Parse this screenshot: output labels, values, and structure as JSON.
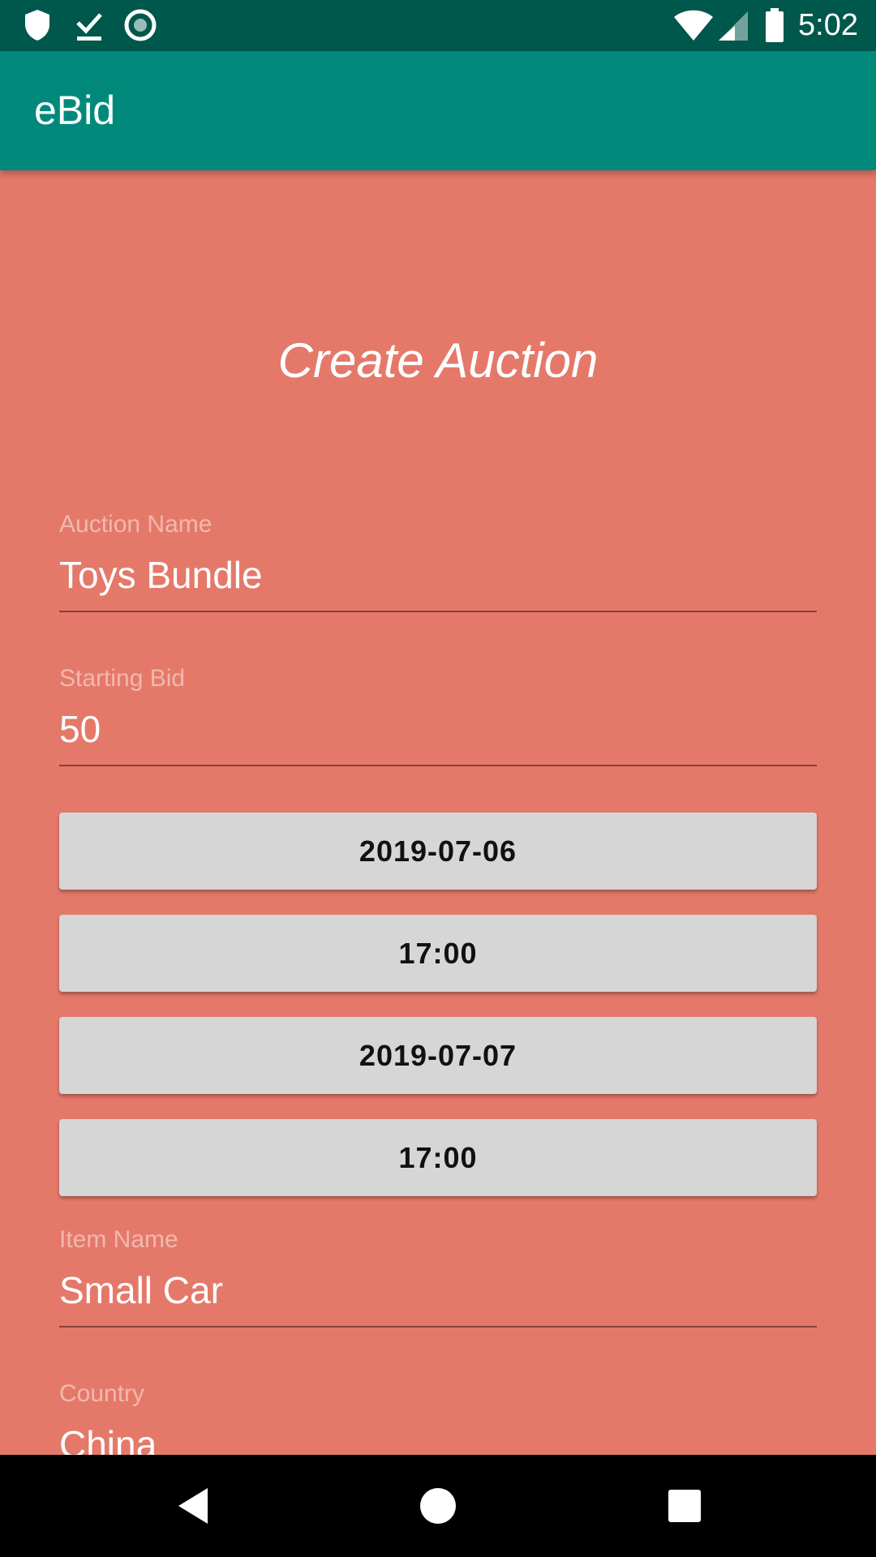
{
  "status_bar": {
    "time": "5:02",
    "icons": [
      "shield-icon",
      "download-done-icon",
      "record-circle-icon",
      "wifi-icon",
      "cell-signal-icon",
      "battery-icon"
    ]
  },
  "app_bar": {
    "title": "eBid"
  },
  "form": {
    "heading": "Create Auction",
    "auction_name": {
      "label": "Auction Name",
      "value": "Toys Bundle"
    },
    "starting_bid": {
      "label": "Starting Bid",
      "value": "50"
    },
    "start_date_button": "2019-07-06",
    "start_time_button": "17:00",
    "end_date_button": "2019-07-07",
    "end_time_button": "17:00",
    "item_name": {
      "label": "Item Name",
      "value": "Small Car"
    },
    "country": {
      "label": "Country",
      "value": "China"
    }
  },
  "nav_bar": {
    "icons": [
      "back-icon",
      "home-icon",
      "recents-icon"
    ]
  },
  "colors": {
    "status_bar": "#00574b",
    "app_bar": "#00897b",
    "background": "#e4796a",
    "button": "#d6d6d6",
    "label": "#f2b8ae"
  }
}
